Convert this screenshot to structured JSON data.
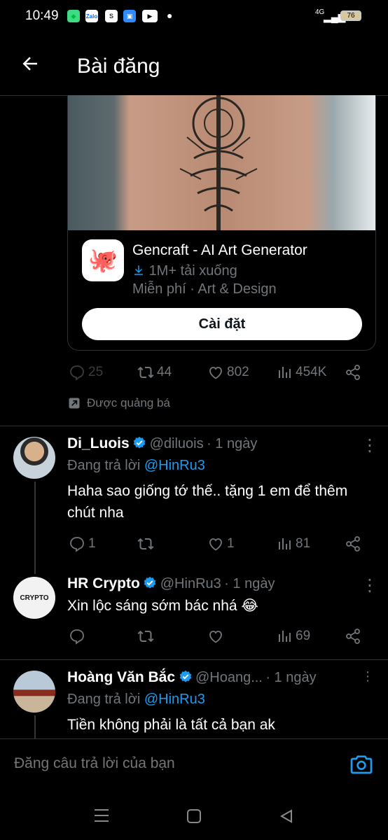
{
  "status": {
    "time": "10:49",
    "battery": "76",
    "network": "4G"
  },
  "header": {
    "title": "Bài đăng"
  },
  "ad": {
    "app_name": "Gencraft - AI Art Generator",
    "downloads": "1M+ tải xuống",
    "category": "Miễn phí · Art & Design",
    "install_label": "Cài đặt",
    "stats": {
      "replies": "25",
      "reposts": "44",
      "likes": "802",
      "views": "454K"
    },
    "promoted": "Được quảng bá"
  },
  "replies": [
    {
      "name": "Di_Luois",
      "handle": "@diluois",
      "time": "· 1 ngày",
      "replying_prefix": "Đang trả lời ",
      "replying_to": "@HinRu3",
      "text": "Haha sao giống tớ thế.. tặng 1 em để thêm chút nha",
      "stats": {
        "replies": "1",
        "reposts": "",
        "likes": "1",
        "views": "81"
      }
    },
    {
      "name": "HR Crypto",
      "handle": "@HinRu3",
      "time": "· 1 ngày",
      "text": "Xin lộc sáng sớm bác nhá 😂",
      "avatar_text": "CRYPTO",
      "stats": {
        "replies": "",
        "reposts": "",
        "likes": "",
        "views": "69"
      }
    },
    {
      "name": "Hoàng Văn Bắc",
      "handle": "@Hoang...",
      "time": "· 1 ngày",
      "replying_prefix": "Đang trả lời ",
      "replying_to": "@HinRu3",
      "text": "Tiền không phải là tất cả bạn ak"
    }
  ],
  "composer": {
    "placeholder": "Đăng câu trả lời của bạn"
  },
  "colors": {
    "accent": "#1d9bf0",
    "background": "#000000",
    "muted": "#71767b"
  }
}
